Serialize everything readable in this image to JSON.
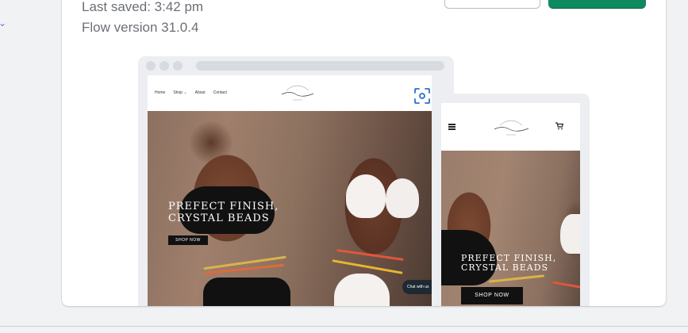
{
  "left_edge": {
    "glyph": "⌄"
  },
  "version_info": {
    "last_saved": "Last saved: 3:42 pm",
    "flow_version": "Flow version 31.0.4"
  },
  "actions": {
    "secondary_label": "",
    "primary_label": ""
  },
  "colors": {
    "primary": "#0f8a5f",
    "scan_accent": "#2c6ecb"
  },
  "desktop_preview": {
    "nav_links": [
      "Home",
      "Shop",
      "About",
      "Contact"
    ],
    "headline_line1": "PREFECT FINISH,",
    "headline_line2": "CRYSTAL BEADS",
    "cta": "SHOP NOW",
    "chat": "Chat with us"
  },
  "mobile_preview": {
    "headline_line1": "PREFECT FINISH,",
    "headline_line2": "CRYSTAL BEADS",
    "cta": "SHOP NOW"
  },
  "icons": {
    "scan": "scan-icon",
    "menu": "hamburger-menu-icon",
    "cart": "cart-icon",
    "dropdown": "chevron-down-icon"
  }
}
